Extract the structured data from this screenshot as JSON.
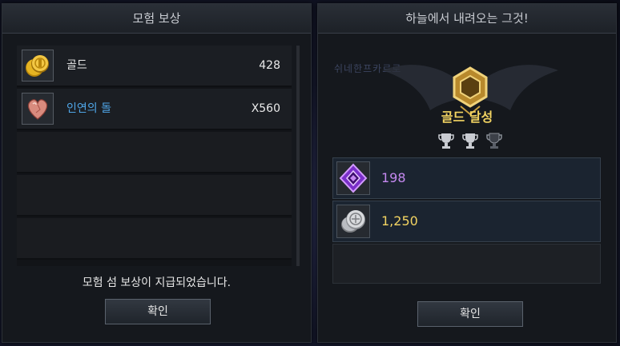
{
  "left_panel": {
    "title": "모험 보상",
    "items": [
      {
        "name": "골드",
        "amount": "428",
        "icon": "gold-coins-icon"
      },
      {
        "name": "인연의 돌",
        "amount": "X560",
        "icon": "heart-stone-icon"
      }
    ],
    "message": "모험 섬 보상이 지급되었습니다.",
    "confirm_label": "확인"
  },
  "right_panel": {
    "title": "하늘에서 내려오는 그것!",
    "background_text": "쉬네한프카르로",
    "achievement": "골드 달성",
    "trophies": [
      "silver-trophy-icon",
      "silver-trophy-icon",
      "dark-trophy-icon"
    ],
    "rewards": [
      {
        "value": "198",
        "icon": "purple-crystal-icon",
        "color": "#c589f0"
      },
      {
        "value": "1,250",
        "icon": "silver-coins-icon",
        "color": "#f3d462"
      }
    ],
    "confirm_label": "확인"
  },
  "colors": {
    "gold_text": "#f3d462",
    "blue_text": "#4fa6e8",
    "purple_text": "#c589f0"
  }
}
